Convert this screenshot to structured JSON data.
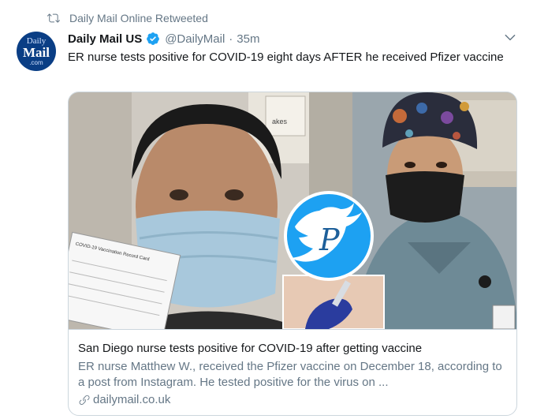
{
  "retweet": {
    "label": "Daily Mail Online Retweeted",
    "icon": "retweet-icon"
  },
  "author": {
    "avatar": {
      "line1": "Daily",
      "line2": "Mail",
      "line3": ".com"
    },
    "name": "Daily Mail US",
    "handle": "@DailyMail",
    "separator": "·",
    "time": "35m",
    "verified_icon": "verified-badge-icon"
  },
  "menu_icon": "chevron-down-icon",
  "tweet": {
    "text": "ER nurse tests positive for COVID-19 eight days AFTER he received Pfizer vaccine"
  },
  "card": {
    "image_text": {
      "card_title": "COVID-19 Vaccination Record Card",
      "sign_text": "akes",
      "logo_letter": "P"
    },
    "title": "San Diego nurse tests positive for COVID-19 after getting vaccine",
    "description": "ER nurse Matthew W., received the Pfizer vaccine on December 18, according to a post from Instagram. He tested positive for the virus on ...",
    "domain": "dailymail.co.uk",
    "link_icon": "link-icon"
  },
  "colors": {
    "accent_blue": "#1da1f2",
    "secondary_text": "#657786",
    "border": "#ccd6dd",
    "avatar_bg": "#0a3e85"
  }
}
